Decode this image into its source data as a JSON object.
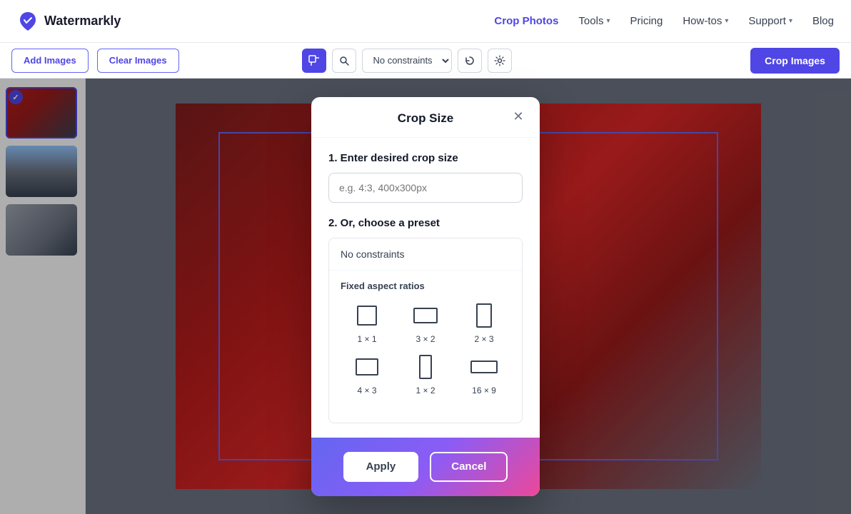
{
  "header": {
    "logo_text": "Watermarkly",
    "nav": [
      {
        "label": "Crop Photos",
        "active": true,
        "has_chevron": false
      },
      {
        "label": "Tools",
        "active": false,
        "has_chevron": true
      },
      {
        "label": "Pricing",
        "active": false,
        "has_chevron": false
      },
      {
        "label": "How-tos",
        "active": false,
        "has_chevron": true
      },
      {
        "label": "Support",
        "active": false,
        "has_chevron": true
      },
      {
        "label": "Blog",
        "active": false,
        "has_chevron": false
      }
    ]
  },
  "toolbar": {
    "add_images_label": "Add Images",
    "clear_images_label": "Clear Images",
    "no_constraints_label": "No constraints",
    "crop_images_label": "Crop Images"
  },
  "modal": {
    "title": "Crop Size",
    "section1_label": "1. Enter desired crop size",
    "input_placeholder": "e.g. 4:3, 400x300px",
    "section2_label": "2. Or, choose a preset",
    "no_constraints_item": "No constraints",
    "fixed_aspect_title": "Fixed aspect ratios",
    "presets": [
      {
        "label": "1 × 1",
        "type": "1x1"
      },
      {
        "label": "3 × 2",
        "type": "3x2"
      },
      {
        "label": "2 × 3",
        "type": "2x3"
      },
      {
        "label": "4 × 3",
        "type": "4x3"
      },
      {
        "label": "1 × 2",
        "type": "1x2"
      },
      {
        "label": "16 × 9",
        "type": "wide"
      }
    ],
    "apply_label": "Apply",
    "cancel_label": "Cancel"
  },
  "thumbnails": [
    {
      "id": 1,
      "selected": true
    },
    {
      "id": 2,
      "selected": false
    },
    {
      "id": 3,
      "selected": false
    }
  ]
}
